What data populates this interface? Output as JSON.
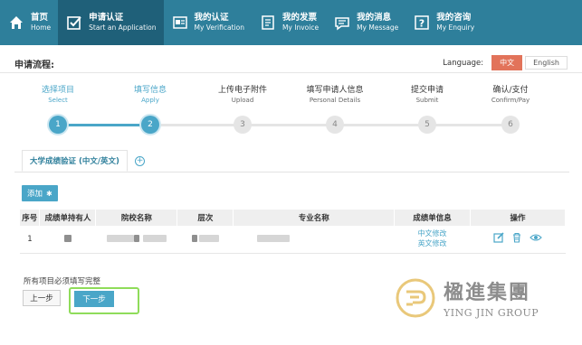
{
  "nav": {
    "items": [
      {
        "zh": "首页",
        "en": "Home",
        "icon": "home-icon"
      },
      {
        "zh": "申请认证",
        "en": "Start an Application",
        "icon": "checkbox-icon"
      },
      {
        "zh": "我的认证",
        "en": "My Verification",
        "icon": "certificate-icon"
      },
      {
        "zh": "我的发票",
        "en": "My Invoice",
        "icon": "invoice-icon"
      },
      {
        "zh": "我的消息",
        "en": "My Message",
        "icon": "message-icon"
      },
      {
        "zh": "我的咨询",
        "en": "My Enquiry",
        "icon": "question-icon"
      }
    ],
    "active_index": 1
  },
  "process": {
    "title": "申请流程:",
    "language_label": "Language:",
    "lang_zh": "中文",
    "lang_en": "English",
    "steps": [
      {
        "zh": "选择项目",
        "en": "Select",
        "num": "1",
        "done": true
      },
      {
        "zh": "填写信息",
        "en": "Apply",
        "num": "2",
        "done": true
      },
      {
        "zh": "上传电子附件",
        "en": "Upload",
        "num": "3",
        "done": false
      },
      {
        "zh": "填写申请人信息",
        "en": "Personal Details",
        "num": "4",
        "done": false
      },
      {
        "zh": "提交申请",
        "en": "Submit",
        "num": "5",
        "done": false
      },
      {
        "zh": "确认/支付",
        "en": "Confirm/Pay",
        "num": "6",
        "done": false
      }
    ]
  },
  "tab": {
    "label": "大学成绩验证 (中文/英文)",
    "add_symbol": "+"
  },
  "add_button": "添加",
  "table": {
    "headers": [
      "序号",
      "成绩单持有人",
      "院校名称",
      "层次",
      "专业名称",
      "成绩单信息",
      "操作"
    ],
    "rows": [
      {
        "index": "1",
        "info_zh": "中文修改",
        "info_en": "英文修改"
      }
    ]
  },
  "footer": {
    "note": "所有项目必须填写完整",
    "prev": "上一步",
    "next": "下一步"
  },
  "watermark": {
    "zh": "楹進集團",
    "en": "YING JIN GROUP"
  },
  "colors": {
    "nav_bg": "#2e7f9b",
    "nav_active": "#1f6079",
    "accent": "#4aa6c8",
    "lang_active": "#e2735a",
    "highlight": "#8fdc5a"
  }
}
